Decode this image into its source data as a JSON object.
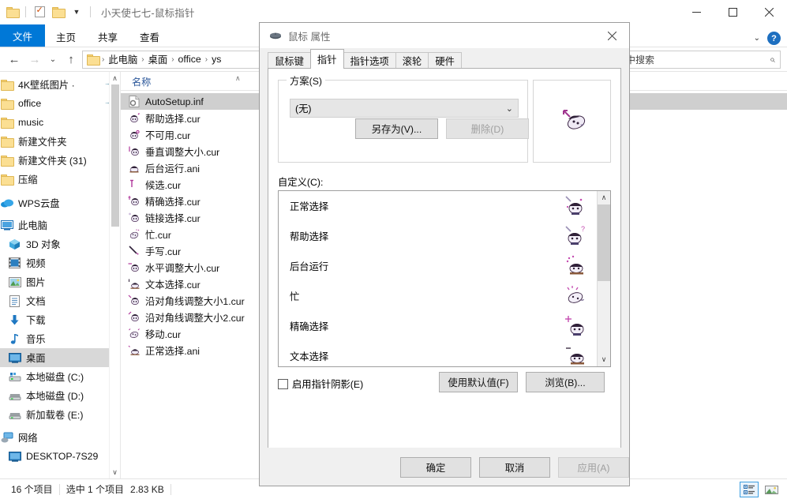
{
  "window": {
    "title": "小天使七七-鼠标指针",
    "controls": {
      "minimize": "—",
      "maximize": "□",
      "close": "✕"
    }
  },
  "ribbon": {
    "tabs": [
      {
        "label": "文件",
        "active_style": "file"
      },
      {
        "label": "主页",
        "active_style": "normal"
      },
      {
        "label": "共享",
        "active_style": "normal"
      },
      {
        "label": "查看",
        "active_style": "normal"
      }
    ],
    "help_label": "?"
  },
  "address": {
    "back": "←",
    "forward": "→",
    "recent": "⌄",
    "up": "↑",
    "crumbs": [
      "此电脑",
      "桌面",
      "office",
      "ys"
    ],
    "search_placeholder": "中搜索"
  },
  "nav": {
    "items": [
      {
        "label": "4K壁纸图片 ·",
        "icon": "folder-icon",
        "pinned": true,
        "state": "normal"
      },
      {
        "label": "office",
        "icon": "folder-icon",
        "pinned": true,
        "state": "normal"
      },
      {
        "label": "music",
        "icon": "folder-icon",
        "pinned": false,
        "state": "normal"
      },
      {
        "label": "新建文件夹",
        "icon": "folder-icon",
        "pinned": false,
        "state": "normal"
      },
      {
        "label": "新建文件夹 (31)",
        "icon": "folder-icon",
        "pinned": false,
        "state": "normal"
      },
      {
        "label": "压缩",
        "icon": "folder-icon",
        "pinned": false,
        "state": "normal"
      },
      {
        "label": "WPS云盘",
        "icon": "cloud-icon",
        "pinned": false,
        "state": "normal"
      },
      {
        "label": "此电脑",
        "icon": "this-pc-icon",
        "pinned": false,
        "state": "normal"
      },
      {
        "label": "3D 对象",
        "icon": "3d-objects-icon",
        "pinned": false,
        "state": "normal"
      },
      {
        "label": "视频",
        "icon": "videos-icon",
        "pinned": false,
        "state": "normal"
      },
      {
        "label": "图片",
        "icon": "pictures-icon",
        "pinned": false,
        "state": "normal"
      },
      {
        "label": "文档",
        "icon": "documents-icon",
        "pinned": false,
        "state": "normal"
      },
      {
        "label": "下载",
        "icon": "downloads-icon",
        "pinned": false,
        "state": "normal"
      },
      {
        "label": "音乐",
        "icon": "music-icon",
        "pinned": false,
        "state": "normal"
      },
      {
        "label": "桌面",
        "icon": "desktop-icon",
        "pinned": false,
        "state": "selected"
      },
      {
        "label": "本地磁盘 (C:)",
        "icon": "system-drive-icon",
        "pinned": false,
        "state": "normal"
      },
      {
        "label": "本地磁盘 (D:)",
        "icon": "drive-icon",
        "pinned": false,
        "state": "normal"
      },
      {
        "label": "新加载卷 (E:)",
        "icon": "drive-icon",
        "pinned": false,
        "state": "normal"
      },
      {
        "label": "网络",
        "icon": "network-icon",
        "pinned": false,
        "state": "normal"
      },
      {
        "label": "DESKTOP-7S29",
        "icon": "computer-icon",
        "pinned": false,
        "state": "normal"
      }
    ]
  },
  "files": {
    "column_header": "名称",
    "rows": [
      {
        "name": "AutoSetup.inf",
        "icon": "inf-file-icon",
        "selected": true
      },
      {
        "name": "帮助选择.cur",
        "icon": "cursor-file-icon",
        "selected": false
      },
      {
        "name": "不可用.cur",
        "icon": "cursor-file-icon",
        "selected": false
      },
      {
        "name": "垂直调整大小.cur",
        "icon": "cursor-file-icon",
        "selected": false
      },
      {
        "name": "后台运行.ani",
        "icon": "cursor-file-icon",
        "selected": false
      },
      {
        "name": "候选.cur",
        "icon": "cursor-file-icon",
        "selected": false
      },
      {
        "name": "精确选择.cur",
        "icon": "cursor-file-icon",
        "selected": false
      },
      {
        "name": "链接选择.cur",
        "icon": "cursor-file-icon",
        "selected": false
      },
      {
        "name": "忙.cur",
        "icon": "cursor-file-icon",
        "selected": false
      },
      {
        "name": "手写.cur",
        "icon": "cursor-file-icon",
        "selected": false
      },
      {
        "name": "水平调整大小.cur",
        "icon": "cursor-file-icon",
        "selected": false
      },
      {
        "name": "文本选择.cur",
        "icon": "cursor-file-icon",
        "selected": false
      },
      {
        "name": "沿对角线调整大小1.cur",
        "icon": "cursor-file-icon",
        "selected": false
      },
      {
        "name": "沿对角线调整大小2.cur",
        "icon": "cursor-file-icon",
        "selected": false
      },
      {
        "name": "移动.cur",
        "icon": "cursor-file-icon",
        "selected": false
      },
      {
        "name": "正常选择.ani",
        "icon": "cursor-file-icon",
        "selected": false
      }
    ]
  },
  "status": {
    "item_count": "16 个项目",
    "selection": "选中 1 个项目",
    "size": "2.83 KB"
  },
  "dialog": {
    "title": "鼠标 属性",
    "close": "✕",
    "tabs": [
      {
        "label": "鼠标键",
        "active": false
      },
      {
        "label": "指针",
        "active": true
      },
      {
        "label": "指针选项",
        "active": false
      },
      {
        "label": "滚轮",
        "active": false
      },
      {
        "label": "硬件",
        "active": false
      }
    ],
    "scheme": {
      "group_label": "方案(S)",
      "selected": "(无)",
      "save_as": "另存为(V)...",
      "delete": "删除(D)",
      "delete_disabled": true
    },
    "customize": {
      "label": "自定义(C):",
      "items": [
        {
          "label": "正常选择"
        },
        {
          "label": "帮助选择"
        },
        {
          "label": "后台运行"
        },
        {
          "label": "忙"
        },
        {
          "label": "精确选择"
        },
        {
          "label": "文本选择"
        }
      ]
    },
    "shadow_checkbox": {
      "label": "启用指针阴影(E)",
      "checked": false
    },
    "use_default": "使用默认值(F)",
    "browse": "浏览(B)...",
    "ok": "确定",
    "cancel": "取消",
    "apply": "应用(A)",
    "apply_disabled": true
  },
  "colors": {
    "accent": "#0078d7",
    "selection": "#cce8ff",
    "file_selection": "#cfcfcf",
    "column_header_text": "#2a5699",
    "dialog_bg": "#f0f0f0",
    "cursor_art": "#7a3c7a"
  }
}
